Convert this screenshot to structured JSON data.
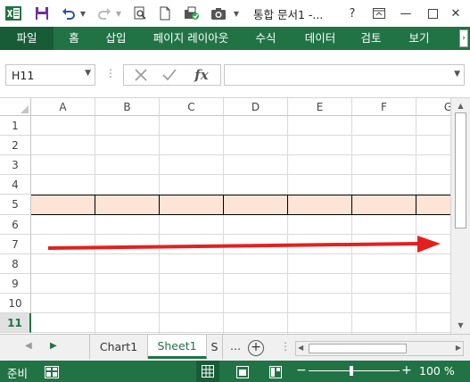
{
  "window": {
    "title": "통합 문서1 -...",
    "help_label": "?",
    "minimize_label": "—",
    "close_label": "✕"
  },
  "ribbon": {
    "tabs": [
      {
        "label": "파일",
        "active": true
      },
      {
        "label": "홈"
      },
      {
        "label": "삽입"
      },
      {
        "label": "페이지 레이아웃"
      },
      {
        "label": "수식"
      },
      {
        "label": "데이터"
      },
      {
        "label": "검토"
      },
      {
        "label": "보기"
      }
    ],
    "scroll_glyph": "›"
  },
  "formula_bar": {
    "name_box": "H11",
    "formula": "",
    "fx_label": "fx",
    "dots": "⋮"
  },
  "grid": {
    "columns": [
      "A",
      "B",
      "C",
      "D",
      "E",
      "F",
      "G"
    ],
    "rows": [
      "1",
      "2",
      "3",
      "4",
      "5",
      "6",
      "7",
      "8",
      "9",
      "10",
      "11"
    ],
    "selected_row": "11",
    "highlighted_row": "5",
    "highlight_color": "#fce4d6",
    "arrow_color": "#e32020"
  },
  "sheets": {
    "tabs": [
      {
        "label": "Chart1"
      },
      {
        "label": "Sheet1",
        "active": true
      },
      {
        "label": "S"
      }
    ],
    "dots": "…",
    "add_label": "+"
  },
  "status": {
    "text": "준비",
    "zoom_minus": "−",
    "zoom_plus": "+",
    "zoom": "100 %"
  },
  "colors": {
    "accent": "#217346",
    "accent_dark": "#185c37"
  }
}
